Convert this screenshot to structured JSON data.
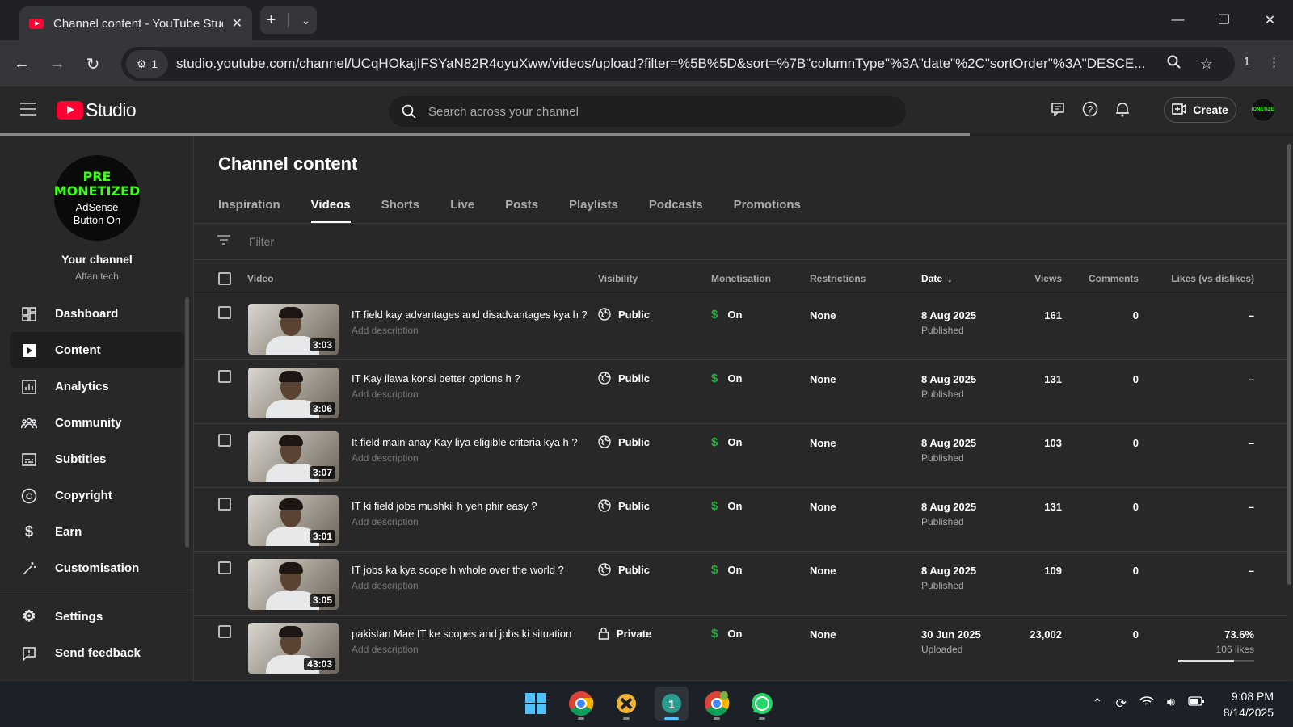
{
  "browser": {
    "tab_title": "Channel content - YouTube Studio",
    "url": "studio.youtube.com/channel/UCqHOkajIFSYaN82R4oyuXww/videos/upload?filter=%5B%5D&sort=%7B\"columnType\"%3A\"date\"%2C\"sortOrder\"%3A\"DESCE...",
    "site_badge": "1",
    "profile_count": "1"
  },
  "studio": {
    "logo_text": "Studio",
    "search_placeholder": "Search across your channel",
    "create_label": "Create"
  },
  "channel": {
    "avatar_line1": "PRE",
    "avatar_line2": "MONETIZED",
    "avatar_line3": "AdSense",
    "avatar_line4": "Button On",
    "title": "Your channel",
    "name": "Affan tech"
  },
  "sidebar": {
    "items": [
      {
        "label": "Dashboard",
        "icon": "dashboard-icon"
      },
      {
        "label": "Content",
        "icon": "content-icon"
      },
      {
        "label": "Analytics",
        "icon": "analytics-icon"
      },
      {
        "label": "Community",
        "icon": "community-icon"
      },
      {
        "label": "Subtitles",
        "icon": "subtitles-icon"
      },
      {
        "label": "Copyright",
        "icon": "copyright-icon"
      },
      {
        "label": "Earn",
        "icon": "earn-icon"
      },
      {
        "label": "Customisation",
        "icon": "customisation-icon"
      }
    ],
    "bottom": [
      {
        "label": "Settings",
        "icon": "settings-icon"
      },
      {
        "label": "Send feedback",
        "icon": "feedback-icon"
      }
    ]
  },
  "main": {
    "title": "Channel content",
    "tabs": [
      "Inspiration",
      "Videos",
      "Shorts",
      "Live",
      "Posts",
      "Playlists",
      "Podcasts",
      "Promotions"
    ],
    "active_tab": "Videos",
    "filter_placeholder": "Filter",
    "columns": {
      "video": "Video",
      "visibility": "Visibility",
      "monetisation": "Monetisation",
      "restrictions": "Restrictions",
      "date": "Date",
      "views": "Views",
      "comments": "Comments",
      "likes": "Likes (vs dislikes)"
    },
    "rows": [
      {
        "title": "IT field kay advantages and disadvantages kya h ?",
        "desc": "Add description",
        "duration": "3:03",
        "visibility": "Public",
        "monetisation": "On",
        "restrictions": "None",
        "date": "8 Aug 2025",
        "status": "Published",
        "views": "161",
        "comments": "0",
        "likes": "–",
        "likes_sub": ""
      },
      {
        "title": "IT Kay ilawa konsi better options h ?",
        "desc": "Add description",
        "duration": "3:06",
        "visibility": "Public",
        "monetisation": "On",
        "restrictions": "None",
        "date": "8 Aug 2025",
        "status": "Published",
        "views": "131",
        "comments": "0",
        "likes": "–",
        "likes_sub": ""
      },
      {
        "title": "It field main anay Kay liya eligible criteria kya h ?",
        "desc": "Add description",
        "duration": "3:07",
        "visibility": "Public",
        "monetisation": "On",
        "restrictions": "None",
        "date": "8 Aug 2025",
        "status": "Published",
        "views": "103",
        "comments": "0",
        "likes": "–",
        "likes_sub": ""
      },
      {
        "title": "IT ki field jobs mushkil h yeh phir easy ?",
        "desc": "Add description",
        "duration": "3:01",
        "visibility": "Public",
        "monetisation": "On",
        "restrictions": "None",
        "date": "8 Aug 2025",
        "status": "Published",
        "views": "131",
        "comments": "0",
        "likes": "–",
        "likes_sub": ""
      },
      {
        "title": "IT jobs ka kya scope h whole over the world ?",
        "desc": "Add description",
        "duration": "3:05",
        "visibility": "Public",
        "monetisation": "On",
        "restrictions": "None",
        "date": "8 Aug 2025",
        "status": "Published",
        "views": "109",
        "comments": "0",
        "likes": "–",
        "likes_sub": ""
      },
      {
        "title": "pakistan Mae IT ke scopes and jobs ki situation",
        "desc": "Add description",
        "duration": "43:03",
        "visibility": "Private",
        "monetisation": "On",
        "restrictions": "None",
        "date": "30 Jun 2025",
        "status": "Uploaded",
        "views": "23,002",
        "comments": "0",
        "likes": "73.6%",
        "likes_sub": "106 likes",
        "likes_ratio": 0.736
      }
    ]
  },
  "taskbar": {
    "time": "9:08 PM",
    "date": "8/14/2025",
    "apps": [
      "windows-start-icon",
      "chrome-icon",
      "app-x-icon",
      "app-active-icon",
      "chrome-profile-icon",
      "whatsapp-icon"
    ]
  },
  "colors": {
    "youtube_red": "#ff0033",
    "monetisation_green": "#2ba640",
    "taskbar_accent": "#4cc2ff",
    "avatar_green": "#39ff14"
  }
}
